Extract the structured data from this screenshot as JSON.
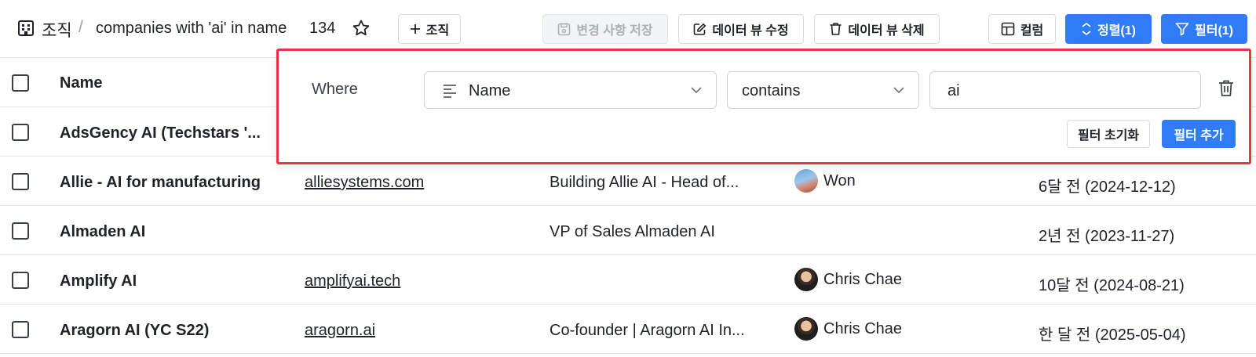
{
  "breadcrumb": {
    "root": "조직",
    "separator": "/",
    "view_name": "companies with 'ai' in name",
    "count": "134"
  },
  "toolbar": {
    "add_label": "조직",
    "save_label": "변경 사항 저장",
    "edit_view_label": "데이터 뷰 수정",
    "delete_view_label": "데이터 뷰 삭제",
    "columns_label": "컬럼",
    "sort_label": "정렬(1)",
    "filter_label": "필터(1)"
  },
  "table": {
    "header": {
      "name": "Name"
    },
    "rows": [
      {
        "name": "AdsGency AI (Techstars '...",
        "domain": "",
        "desc": "",
        "owner": "",
        "date": ""
      },
      {
        "name": "Allie - AI for manufacturing",
        "domain": "alliesystems.com",
        "desc": "Building Allie AI - Head of...",
        "owner": "Won",
        "date": "6달 전 (2024-12-12)"
      },
      {
        "name": "Almaden AI",
        "domain": "",
        "desc": "VP of Sales Almaden AI",
        "owner": "",
        "date": "2년 전 (2023-11-27)"
      },
      {
        "name": "Amplify AI",
        "domain": "amplifyai.tech",
        "desc": "",
        "owner": "Chris Chae",
        "date": "10달 전 (2024-08-21)"
      },
      {
        "name": "Aragorn AI (YC S22)",
        "domain": "aragorn.ai",
        "desc": "Co-founder | Aragorn AI In...",
        "owner": "Chris Chae",
        "date": "한 달 전 (2025-05-04)"
      }
    ]
  },
  "filter": {
    "where_label": "Where",
    "field": "Name",
    "operator": "contains",
    "value": "ai",
    "reset_label": "필터 초기화",
    "add_label": "필터 추가"
  },
  "colors": {
    "primary": "#2f7cf6",
    "highlight_border": "#e8344a",
    "border": "#d8dbe0"
  }
}
